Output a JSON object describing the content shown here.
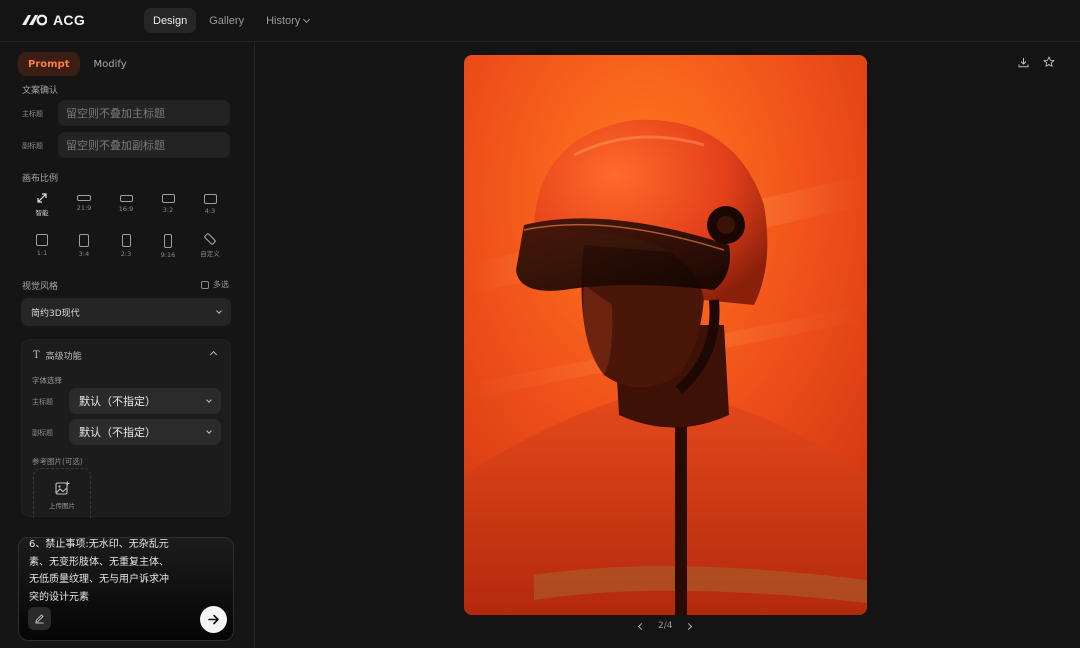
{
  "app": {
    "name": "ACG",
    "logo_icon": "acg-logo-icon"
  },
  "nav": {
    "tabs": [
      {
        "label": "Design",
        "active": true
      },
      {
        "label": "Gallery",
        "active": false
      },
      {
        "label": "History",
        "active": false,
        "has_dropdown": true
      }
    ]
  },
  "sidebar": {
    "subtabs": [
      {
        "label": "Prompt",
        "active": true
      },
      {
        "label": "Modify",
        "active": false
      }
    ],
    "copy_section": {
      "title": "文案确认",
      "main_title": {
        "label": "主标题",
        "placeholder": "留空则不叠加主标题",
        "value": ""
      },
      "subtitle": {
        "label": "副标题",
        "placeholder": "留空则不叠加副标题",
        "value": ""
      }
    },
    "ratio_section": {
      "title": "画布比例",
      "options": [
        {
          "label": "智能",
          "icon": "expand-arrows-icon",
          "active": true
        },
        {
          "label": "21:9",
          "icon": "ratio-21-9-icon",
          "active": false
        },
        {
          "label": "16:9",
          "icon": "ratio-16-9-icon",
          "active": false
        },
        {
          "label": "3:2",
          "icon": "ratio-3-2-icon",
          "active": false
        },
        {
          "label": "4:3",
          "icon": "ratio-4-3-icon",
          "active": false
        },
        {
          "label": "1:1",
          "icon": "ratio-1-1-icon",
          "active": false
        },
        {
          "label": "3:4",
          "icon": "ratio-3-4-icon",
          "active": false
        },
        {
          "label": "2:3",
          "icon": "ratio-2-3-icon",
          "active": false
        },
        {
          "label": "9:16",
          "icon": "ratio-9-16-icon",
          "active": false
        },
        {
          "label": "自定义",
          "icon": "custom-ratio-icon",
          "active": false
        }
      ]
    },
    "style_section": {
      "title": "视觉风格",
      "multi_select_label": "多选",
      "multi_select_checked": false,
      "selected": "简约3D现代"
    },
    "advanced": {
      "title": "高级功能",
      "font_section_label": "字体选择",
      "main_title_font": {
        "label": "主标题",
        "value": "默认（不指定）"
      },
      "subtitle_font": {
        "label": "副标题",
        "value": "默认（不指定）"
      },
      "reference_label": "参考图片(可选)",
      "upload_label": "上传图片"
    },
    "prompt": {
      "text": "6、禁止事项:无水印、无杂乱元\n素、无变形肢体、无重复主体、\n无低质量纹理、无与用户诉求冲\n突的设计元素"
    }
  },
  "main": {
    "image_alt": "Portrait of a person in an orange helmet with visor and orange zip jacket against an orange background",
    "pager": {
      "current": 2,
      "total": 4,
      "text": "2/4"
    },
    "toolbar": {
      "download_icon": "download-icon",
      "favorite_icon": "star-icon"
    }
  },
  "colors": {
    "accent": "#ff7a45",
    "background": "#141414",
    "panel": "#1c1c1c"
  }
}
